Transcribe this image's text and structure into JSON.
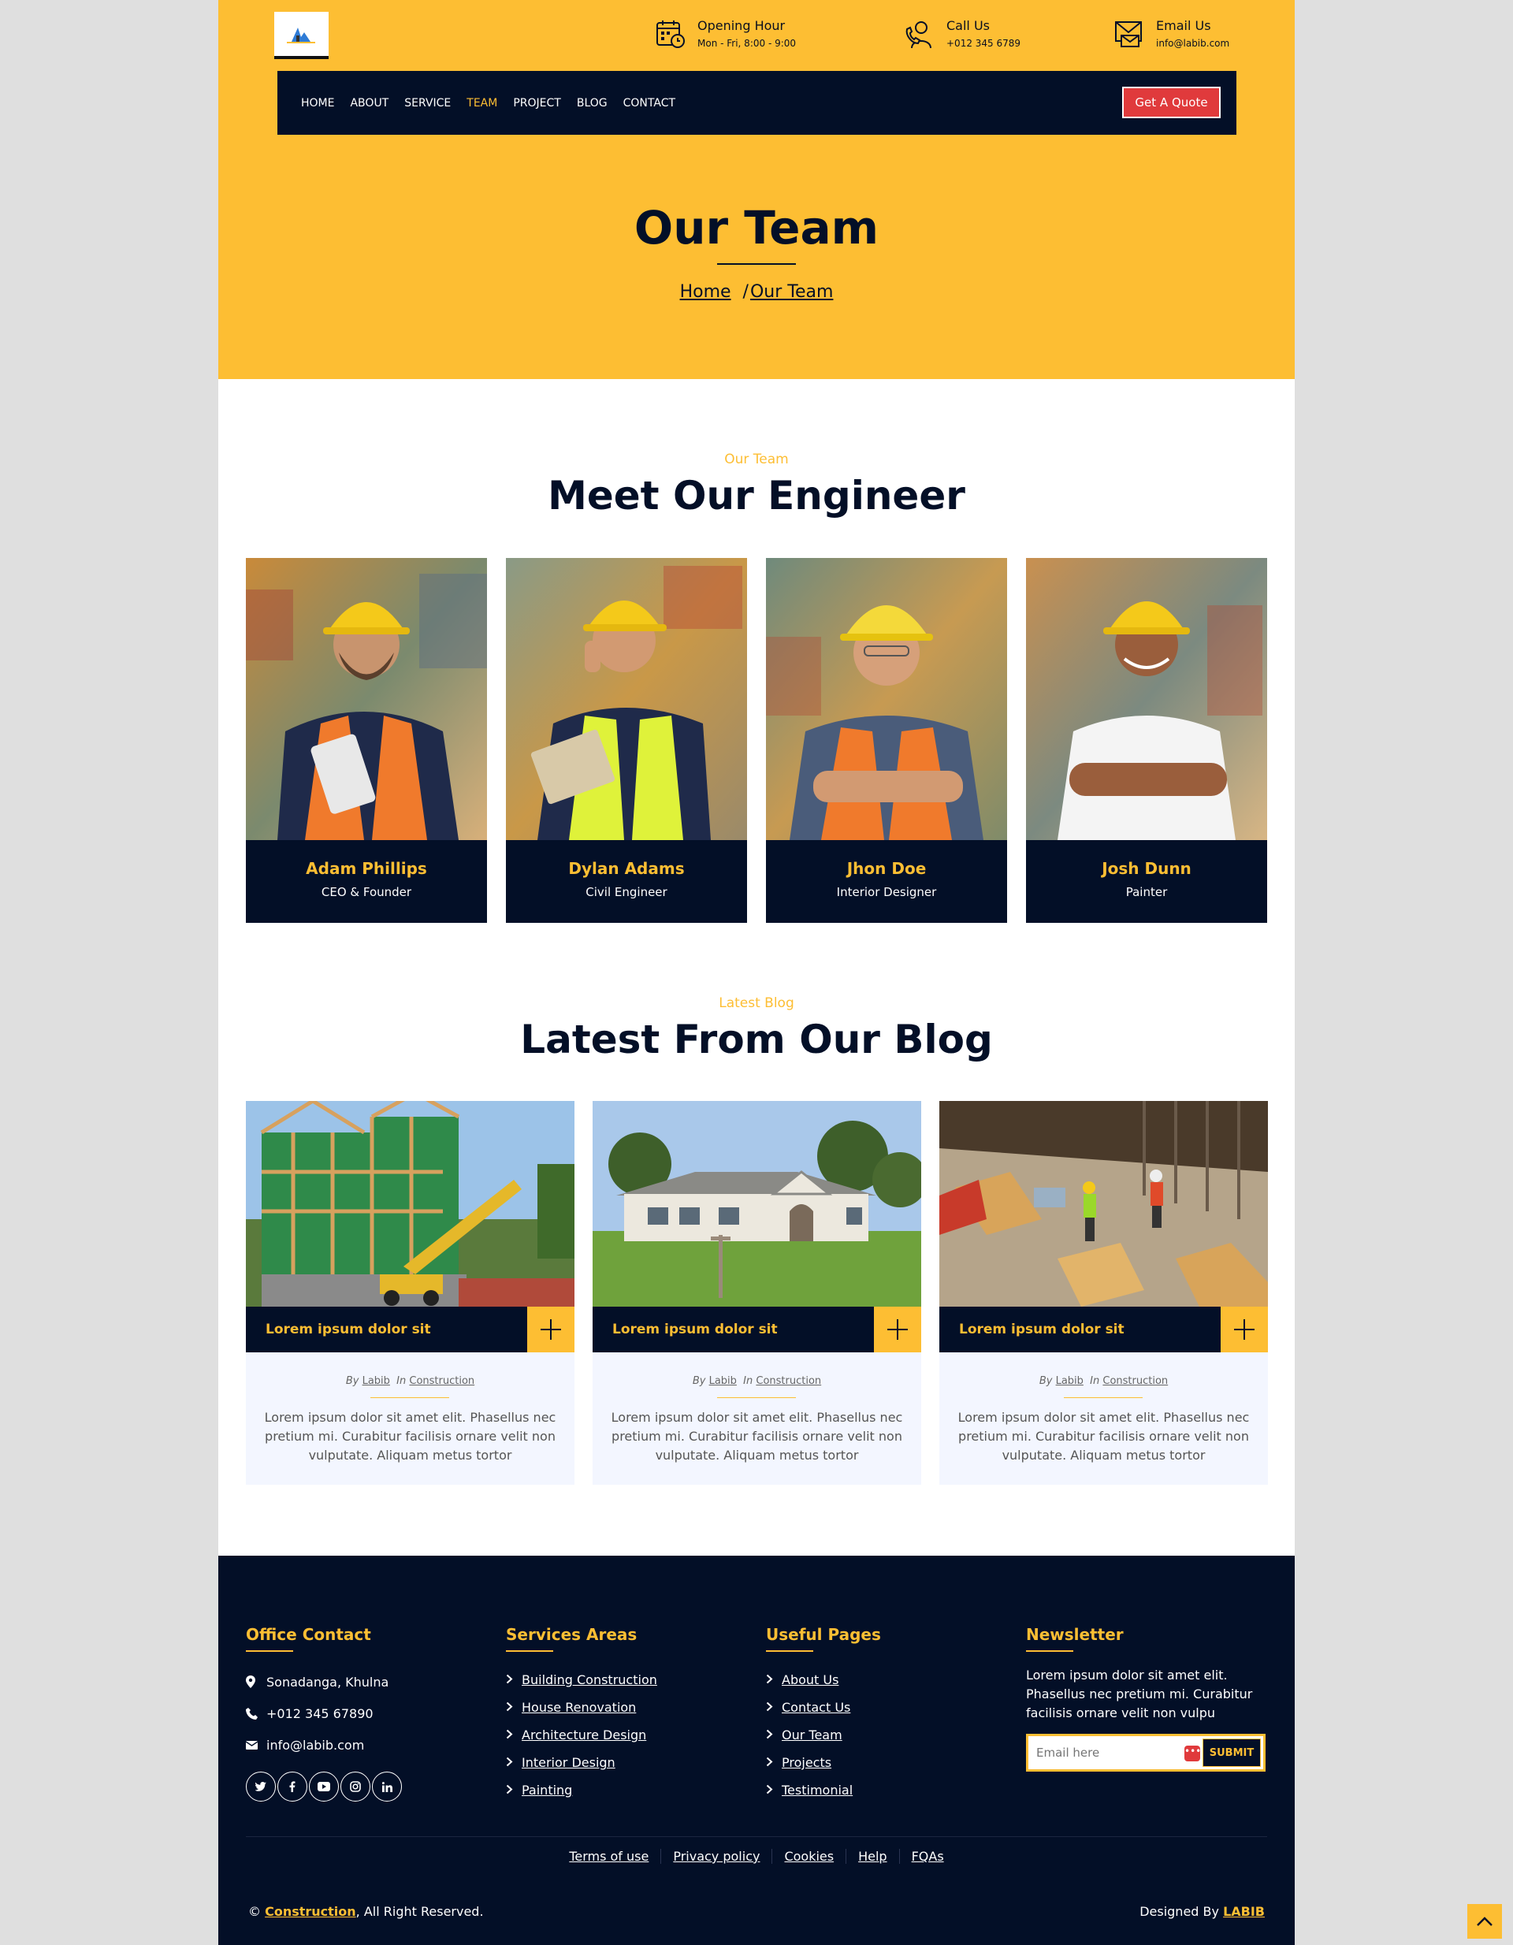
{
  "header": {
    "opening": {
      "title": "Opening Hour",
      "value": "Mon - Fri, 8:00 - 9:00",
      "icon": "calendar-clock-icon"
    },
    "call": {
      "title": "Call Us",
      "value": "+012 345 6789",
      "icon": "phone-support-icon"
    },
    "email": {
      "title": "Email Us",
      "value": "info@labib.com",
      "icon": "envelope-icon"
    }
  },
  "nav": {
    "items": [
      "HOME",
      "ABOUT",
      "SERVICE",
      "TEAM",
      "PROJECT",
      "BLOG",
      "CONTACT"
    ],
    "active": "TEAM",
    "quote_label": "Get A Quote"
  },
  "hero": {
    "title": "Our Team",
    "breadcrumb_home": "Home",
    "breadcrumb_sep": "/",
    "breadcrumb_current": "Our Team"
  },
  "team": {
    "subtitle": "Our Team",
    "title": "Meet Our Engineer",
    "members": [
      {
        "name": "Adam Phillips",
        "role": "CEO & Founder"
      },
      {
        "name": "Dylan Adams",
        "role": "Civil Engineer"
      },
      {
        "name": "Jhon Doe",
        "role": "Interior Designer"
      },
      {
        "name": "Josh Dunn",
        "role": "Painter"
      }
    ]
  },
  "blog": {
    "subtitle": "Latest Blog",
    "title": "Latest From Our Blog",
    "posts": [
      {
        "title": "Lorem ipsum dolor sit",
        "by": "By",
        "author": "Labib",
        "in": "In",
        "category": "Construction",
        "text": "Lorem ipsum dolor sit amet elit. Phasellus nec pretium mi. Curabitur facilisis ornare velit non vulputate. Aliquam metus tortor"
      },
      {
        "title": "Lorem ipsum dolor sit",
        "by": "By",
        "author": "Labib",
        "in": "In",
        "category": "Construction",
        "text": "Lorem ipsum dolor sit amet elit. Phasellus nec pretium mi. Curabitur facilisis ornare velit non vulputate. Aliquam metus tortor"
      },
      {
        "title": "Lorem ipsum dolor sit",
        "by": "By",
        "author": "Labib",
        "in": "In",
        "category": "Construction",
        "text": "Lorem ipsum dolor sit amet elit. Phasellus nec pretium mi. Curabitur facilisis ornare velit non vulputate. Aliquam metus tortor"
      }
    ]
  },
  "footer": {
    "office": {
      "title": "Office Contact",
      "address": "Sonadanga, Khulna",
      "phone": "+012 345 67890",
      "email": "info@labib.com"
    },
    "services": {
      "title": "Services Areas",
      "links": [
        "Building Construction",
        "House Renovation",
        "Architecture Design",
        "Interior Design",
        "Painting"
      ]
    },
    "pages": {
      "title": "Useful Pages",
      "links": [
        "About Us",
        "Contact Us",
        "Our Team",
        "Projects",
        "Testimonial"
      ]
    },
    "newsletter": {
      "title": "Newsletter",
      "text": "Lorem ipsum dolor sit amet elit. Phasellus nec pretium mi. Curabitur facilisis ornare velit non vulpu",
      "placeholder": "Email here",
      "button": "SUBMIT"
    },
    "legal": [
      "Terms of use",
      "Privacy policy",
      "Cookies",
      "Help",
      "FQAs"
    ],
    "copy_prefix": "©",
    "copy_brand": "Construction",
    "copy_suffix": ", All Right Reserved.",
    "designed_by": "Designed By",
    "designer": "LABIB"
  },
  "colors": {
    "accent": "#fdbe33",
    "dark": "#030f27",
    "red": "#e03a3c"
  }
}
